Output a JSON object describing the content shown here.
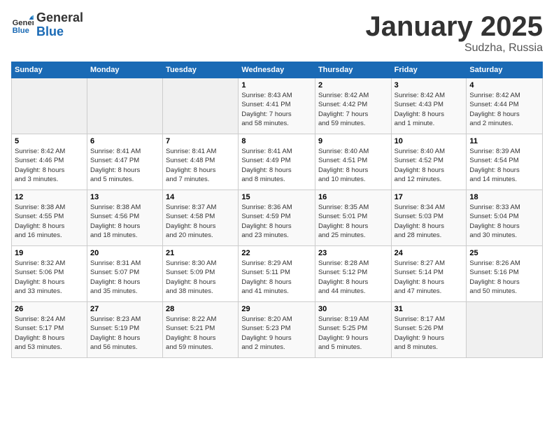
{
  "logo": {
    "general": "General",
    "blue": "Blue"
  },
  "header": {
    "title": "January 2025",
    "subtitle": "Sudzha, Russia"
  },
  "weekdays": [
    "Sunday",
    "Monday",
    "Tuesday",
    "Wednesday",
    "Thursday",
    "Friday",
    "Saturday"
  ],
  "weeks": [
    [
      {
        "day": "",
        "info": ""
      },
      {
        "day": "",
        "info": ""
      },
      {
        "day": "",
        "info": ""
      },
      {
        "day": "1",
        "info": "Sunrise: 8:43 AM\nSunset: 4:41 PM\nDaylight: 7 hours\nand 58 minutes."
      },
      {
        "day": "2",
        "info": "Sunrise: 8:42 AM\nSunset: 4:42 PM\nDaylight: 7 hours\nand 59 minutes."
      },
      {
        "day": "3",
        "info": "Sunrise: 8:42 AM\nSunset: 4:43 PM\nDaylight: 8 hours\nand 1 minute."
      },
      {
        "day": "4",
        "info": "Sunrise: 8:42 AM\nSunset: 4:44 PM\nDaylight: 8 hours\nand 2 minutes."
      }
    ],
    [
      {
        "day": "5",
        "info": "Sunrise: 8:42 AM\nSunset: 4:46 PM\nDaylight: 8 hours\nand 3 minutes."
      },
      {
        "day": "6",
        "info": "Sunrise: 8:41 AM\nSunset: 4:47 PM\nDaylight: 8 hours\nand 5 minutes."
      },
      {
        "day": "7",
        "info": "Sunrise: 8:41 AM\nSunset: 4:48 PM\nDaylight: 8 hours\nand 7 minutes."
      },
      {
        "day": "8",
        "info": "Sunrise: 8:41 AM\nSunset: 4:49 PM\nDaylight: 8 hours\nand 8 minutes."
      },
      {
        "day": "9",
        "info": "Sunrise: 8:40 AM\nSunset: 4:51 PM\nDaylight: 8 hours\nand 10 minutes."
      },
      {
        "day": "10",
        "info": "Sunrise: 8:40 AM\nSunset: 4:52 PM\nDaylight: 8 hours\nand 12 minutes."
      },
      {
        "day": "11",
        "info": "Sunrise: 8:39 AM\nSunset: 4:54 PM\nDaylight: 8 hours\nand 14 minutes."
      }
    ],
    [
      {
        "day": "12",
        "info": "Sunrise: 8:38 AM\nSunset: 4:55 PM\nDaylight: 8 hours\nand 16 minutes."
      },
      {
        "day": "13",
        "info": "Sunrise: 8:38 AM\nSunset: 4:56 PM\nDaylight: 8 hours\nand 18 minutes."
      },
      {
        "day": "14",
        "info": "Sunrise: 8:37 AM\nSunset: 4:58 PM\nDaylight: 8 hours\nand 20 minutes."
      },
      {
        "day": "15",
        "info": "Sunrise: 8:36 AM\nSunset: 4:59 PM\nDaylight: 8 hours\nand 23 minutes."
      },
      {
        "day": "16",
        "info": "Sunrise: 8:35 AM\nSunset: 5:01 PM\nDaylight: 8 hours\nand 25 minutes."
      },
      {
        "day": "17",
        "info": "Sunrise: 8:34 AM\nSunset: 5:03 PM\nDaylight: 8 hours\nand 28 minutes."
      },
      {
        "day": "18",
        "info": "Sunrise: 8:33 AM\nSunset: 5:04 PM\nDaylight: 8 hours\nand 30 minutes."
      }
    ],
    [
      {
        "day": "19",
        "info": "Sunrise: 8:32 AM\nSunset: 5:06 PM\nDaylight: 8 hours\nand 33 minutes."
      },
      {
        "day": "20",
        "info": "Sunrise: 8:31 AM\nSunset: 5:07 PM\nDaylight: 8 hours\nand 35 minutes."
      },
      {
        "day": "21",
        "info": "Sunrise: 8:30 AM\nSunset: 5:09 PM\nDaylight: 8 hours\nand 38 minutes."
      },
      {
        "day": "22",
        "info": "Sunrise: 8:29 AM\nSunset: 5:11 PM\nDaylight: 8 hours\nand 41 minutes."
      },
      {
        "day": "23",
        "info": "Sunrise: 8:28 AM\nSunset: 5:12 PM\nDaylight: 8 hours\nand 44 minutes."
      },
      {
        "day": "24",
        "info": "Sunrise: 8:27 AM\nSunset: 5:14 PM\nDaylight: 8 hours\nand 47 minutes."
      },
      {
        "day": "25",
        "info": "Sunrise: 8:26 AM\nSunset: 5:16 PM\nDaylight: 8 hours\nand 50 minutes."
      }
    ],
    [
      {
        "day": "26",
        "info": "Sunrise: 8:24 AM\nSunset: 5:17 PM\nDaylight: 8 hours\nand 53 minutes."
      },
      {
        "day": "27",
        "info": "Sunrise: 8:23 AM\nSunset: 5:19 PM\nDaylight: 8 hours\nand 56 minutes."
      },
      {
        "day": "28",
        "info": "Sunrise: 8:22 AM\nSunset: 5:21 PM\nDaylight: 8 hours\nand 59 minutes."
      },
      {
        "day": "29",
        "info": "Sunrise: 8:20 AM\nSunset: 5:23 PM\nDaylight: 9 hours\nand 2 minutes."
      },
      {
        "day": "30",
        "info": "Sunrise: 8:19 AM\nSunset: 5:25 PM\nDaylight: 9 hours\nand 5 minutes."
      },
      {
        "day": "31",
        "info": "Sunrise: 8:17 AM\nSunset: 5:26 PM\nDaylight: 9 hours\nand 8 minutes."
      },
      {
        "day": "",
        "info": ""
      }
    ]
  ]
}
